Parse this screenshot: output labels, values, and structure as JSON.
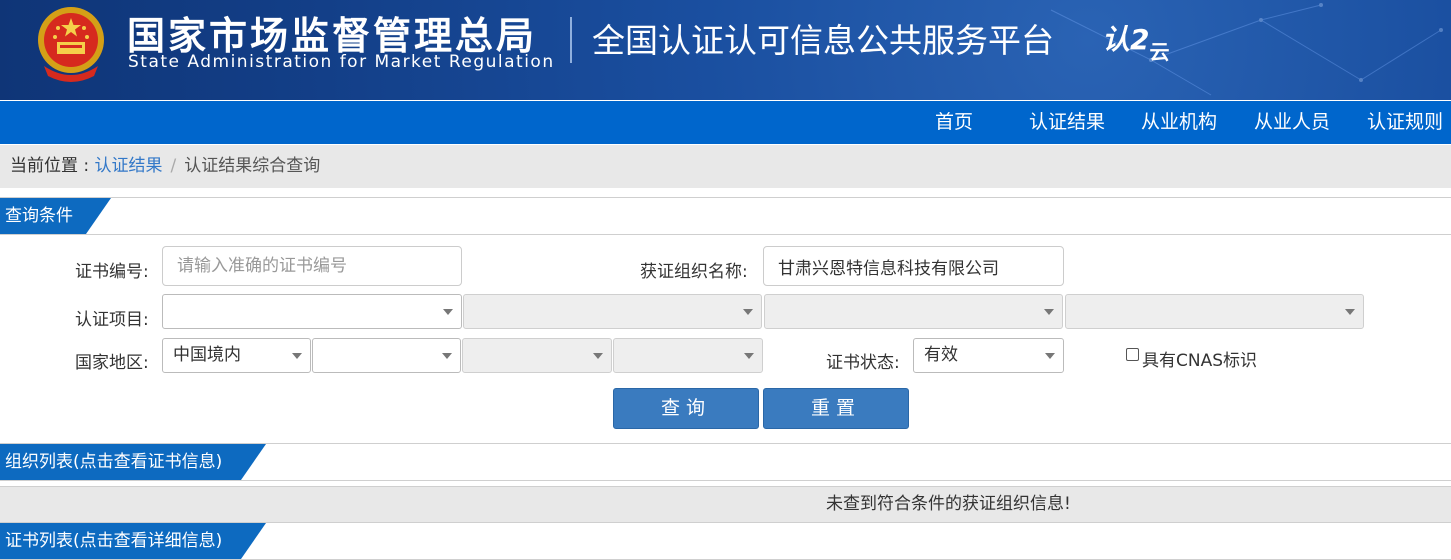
{
  "header": {
    "agency_cn": "国家市场监督管理总局",
    "agency_en": "State Administration  for  Market Regulation",
    "platform_title": "全国认证认可信息公共服务平台",
    "logo_main": "认",
    "logo_swirl": "2",
    "logo_small": "云"
  },
  "nav": {
    "items": [
      "首页",
      "认证结果",
      "从业机构",
      "从业人员",
      "认证规则"
    ]
  },
  "breadcrumb": {
    "prefix": "当前位置 : ",
    "link": "认证结果",
    "separator": "/",
    "current": "认证结果综合查询"
  },
  "sections": {
    "query": "查询条件",
    "org_list": "组织列表(点击查看证书信息)",
    "cert_list": "证书列表(点击查看详细信息)"
  },
  "form": {
    "cert_no_label": "证书编号:",
    "cert_no_placeholder": "请输入准确的证书编号",
    "cert_no_value": "",
    "org_name_label": "获证组织名称:",
    "org_name_value": "甘肃兴恩特信息科技有限公司",
    "project_label": "认证项目:",
    "project_values": [
      "",
      "",
      "",
      ""
    ],
    "region_label": "国家地区:",
    "region_values": [
      "中国境内",
      "",
      "",
      ""
    ],
    "status_label": "证书状态:",
    "status_value": "有效",
    "cnas_label": "具有CNAS标识",
    "query_button": "查询",
    "reset_button": "重置"
  },
  "results": {
    "empty_message": "未查到符合条件的获证组织信息!"
  },
  "colors": {
    "header_bg": "#1a4fa0",
    "nav_bg": "#0066cc",
    "section_tab": "#0d6ac0",
    "button": "#3a7bbf",
    "link": "#3378c8"
  }
}
